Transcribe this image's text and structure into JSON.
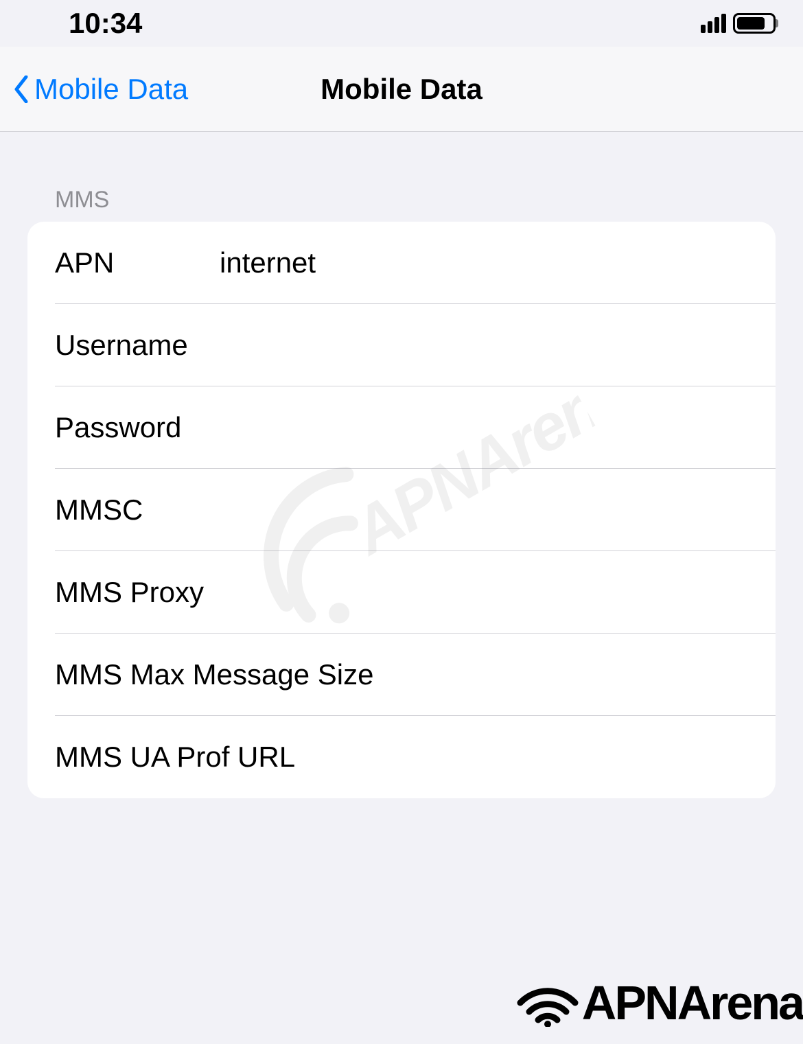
{
  "statusBar": {
    "time": "10:34"
  },
  "navBar": {
    "backLabel": "Mobile Data",
    "title": "Mobile Data"
  },
  "section": {
    "header": "MMS",
    "rows": [
      {
        "label": "APN",
        "value": "internet"
      },
      {
        "label": "Username",
        "value": ""
      },
      {
        "label": "Password",
        "value": ""
      },
      {
        "label": "MMSC",
        "value": ""
      },
      {
        "label": "MMS Proxy",
        "value": ""
      },
      {
        "label": "MMS Max Message Size",
        "value": ""
      },
      {
        "label": "MMS UA Prof URL",
        "value": ""
      }
    ]
  },
  "watermark": {
    "text": "APNArena"
  },
  "bottomLogo": {
    "text": "APNArena"
  }
}
